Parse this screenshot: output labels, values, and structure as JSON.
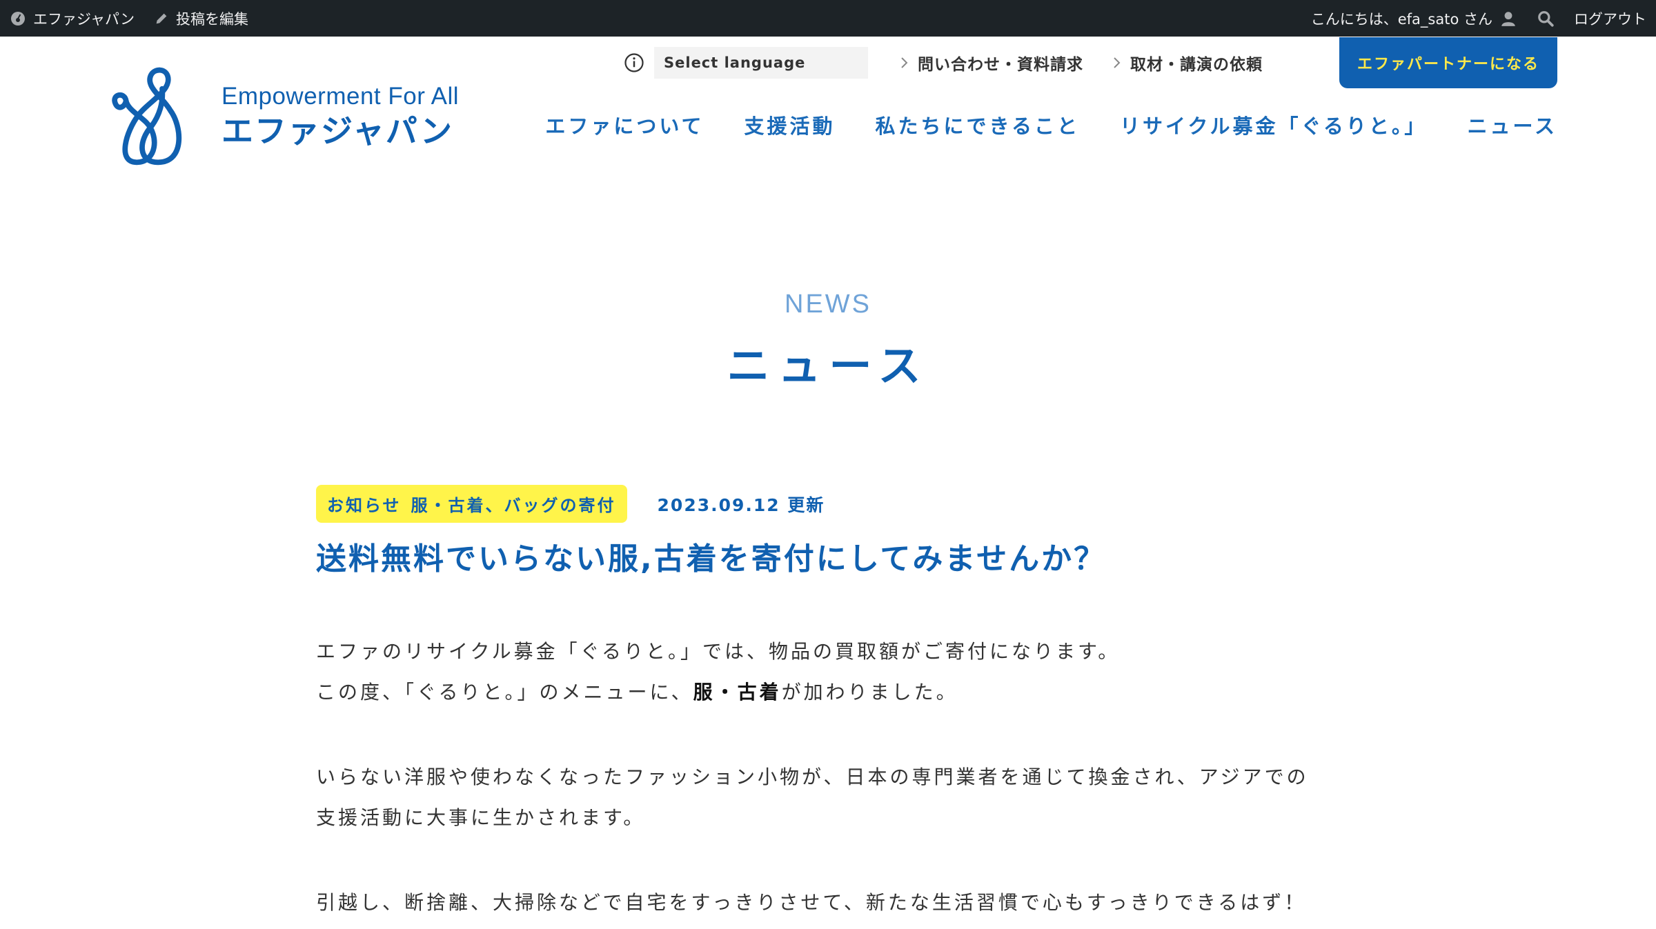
{
  "admin_bar": {
    "site_name": "エファジャパン",
    "edit_post": "投稿を編集",
    "greeting": "こんにちは、efa_sato さん",
    "logout": "ログアウト"
  },
  "logo": {
    "en": "Empowerment For All",
    "ja": "エファジャパン"
  },
  "utility": {
    "language_placeholder": "Select language",
    "contact": "問い合わせ・資料請求",
    "coverage": "取材・講演の依頼",
    "partner_button": "エファパートナーになる"
  },
  "nav": [
    {
      "label": "エファについて"
    },
    {
      "label": "支援活動"
    },
    {
      "label": "私たちにできること"
    },
    {
      "label": "リサイクル募金「ぐるりと。」"
    },
    {
      "label": "ニュース"
    }
  ],
  "page": {
    "heading_en": "NEWS",
    "heading_ja": "ニュース"
  },
  "article": {
    "categories": [
      "お知らせ",
      "服・古着、バッグの寄付"
    ],
    "date": "2023.09.12 更新",
    "title": "送料無料でいらない服,古着を寄付にしてみませんか？",
    "p1_line1": "エファのリサイクル募金「ぐるりと。」では、物品の買取額がご寄付になります。",
    "p1_line2_pre": "この度、「ぐるりと。」のメニューに、",
    "p1_line2_bold": "服・古着",
    "p1_line2_post": "が加わりました。",
    "p2_line1": "いらない洋服や使わなくなったファッション小物が、日本の専門業者を通じて換金され、アジアでの",
    "p2_line2": "支援活動に大事に生かされます。",
    "p3_line1": "引越し、断捨離、大掃除などで自宅をすっきりさせて、新たな生活習慣で心もすっきりできるはず！"
  },
  "colors": {
    "brand_blue": "#1060b0",
    "accent_yellow": "#fff44a",
    "admin_bar": "#1d2327"
  }
}
